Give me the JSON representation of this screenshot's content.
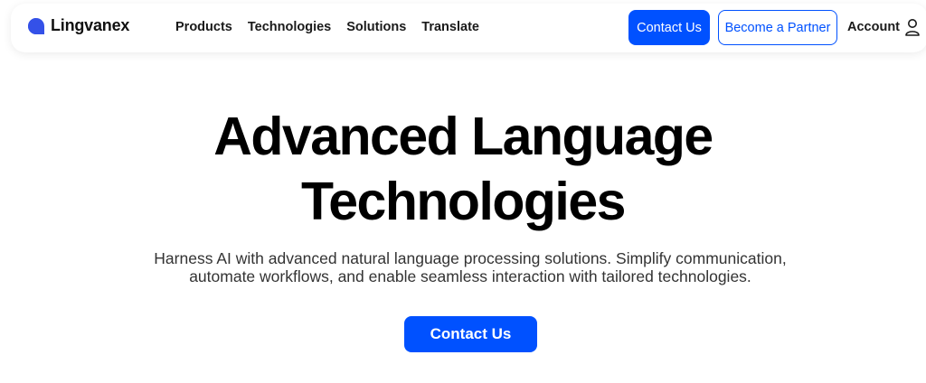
{
  "brand": {
    "name": "Lingvanex",
    "icon": "lingvanex-logo-icon",
    "color": "#3451e8"
  },
  "nav": {
    "links": [
      "Products",
      "Technologies",
      "Solutions",
      "Translate"
    ],
    "contact_label": "Contact Us",
    "partner_label": "Become a Partner",
    "account_label": "Account",
    "account_icon": "user-icon"
  },
  "hero": {
    "title_line1": "Advanced Language",
    "title_line2": "Technologies",
    "subtitle_line1": "Harness AI with advanced natural language processing solutions. Simplify communication,",
    "subtitle_line2": "automate workflows, and enable seamless interaction with tailored technologies.",
    "cta_label": "Contact Us"
  },
  "colors": {
    "accent": "#0051ff",
    "text": "#111111",
    "background": "#ffffff"
  }
}
